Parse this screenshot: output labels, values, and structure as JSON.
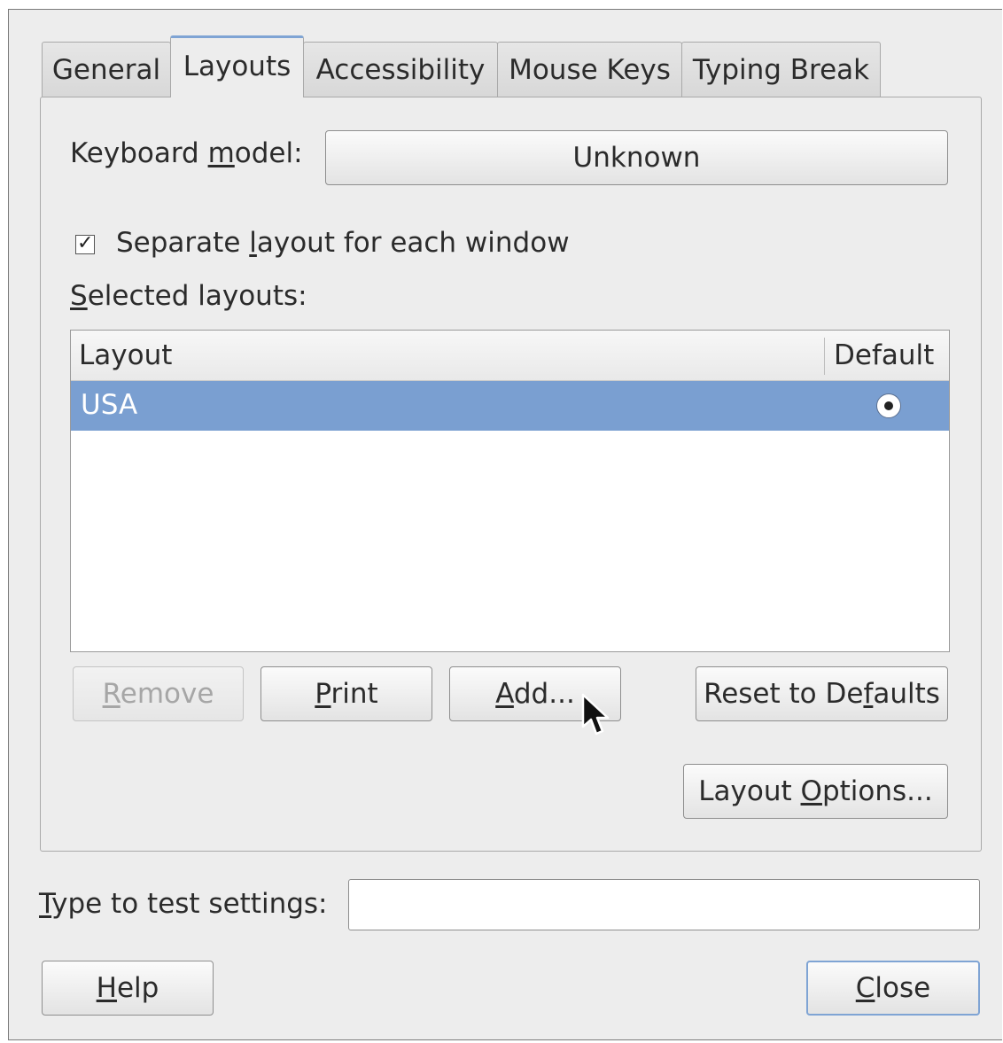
{
  "tabs": {
    "general": "General",
    "layouts": "Layouts",
    "accessibility": "Accessibility",
    "mouse_keys": "Mouse Keys",
    "typing_break": "Typing Break"
  },
  "keyboard_model": {
    "label_pre": "Keyboard ",
    "label_mn": "m",
    "label_post": "odel:",
    "value": "Unknown"
  },
  "separate_layout": {
    "checked": true,
    "check_glyph": "✓",
    "label_pre": "Separate ",
    "label_mn": "l",
    "label_post": "ayout for each window"
  },
  "selected_layouts": {
    "label_mn": "S",
    "label_post": "elected layouts:"
  },
  "layout_list": {
    "columns": [
      "Layout",
      "Default"
    ],
    "rows": [
      {
        "layout": "USA",
        "default": true,
        "selected": true
      }
    ]
  },
  "buttons": {
    "remove": {
      "mn": "R",
      "rest": "emove",
      "disabled": true
    },
    "print": {
      "mn": "P",
      "rest": "rint"
    },
    "add": {
      "mn": "A",
      "rest": "dd..."
    },
    "reset": {
      "pre": "Reset to De",
      "mn": "f",
      "rest": "aults"
    },
    "layout_options": {
      "pre": "Layout ",
      "mn": "O",
      "rest": "ptions..."
    },
    "help": {
      "mn": "H",
      "rest": "elp"
    },
    "close": {
      "mn": "C",
      "rest": "lose"
    }
  },
  "test_settings": {
    "label_mn": "T",
    "label_post": "ype to test settings:",
    "value": ""
  },
  "colors": {
    "selection": "#7a9fd1",
    "focus_border": "#7fa4d4",
    "window_bg": "#ededed"
  },
  "cursor_icon": "mouse-pointer-icon"
}
